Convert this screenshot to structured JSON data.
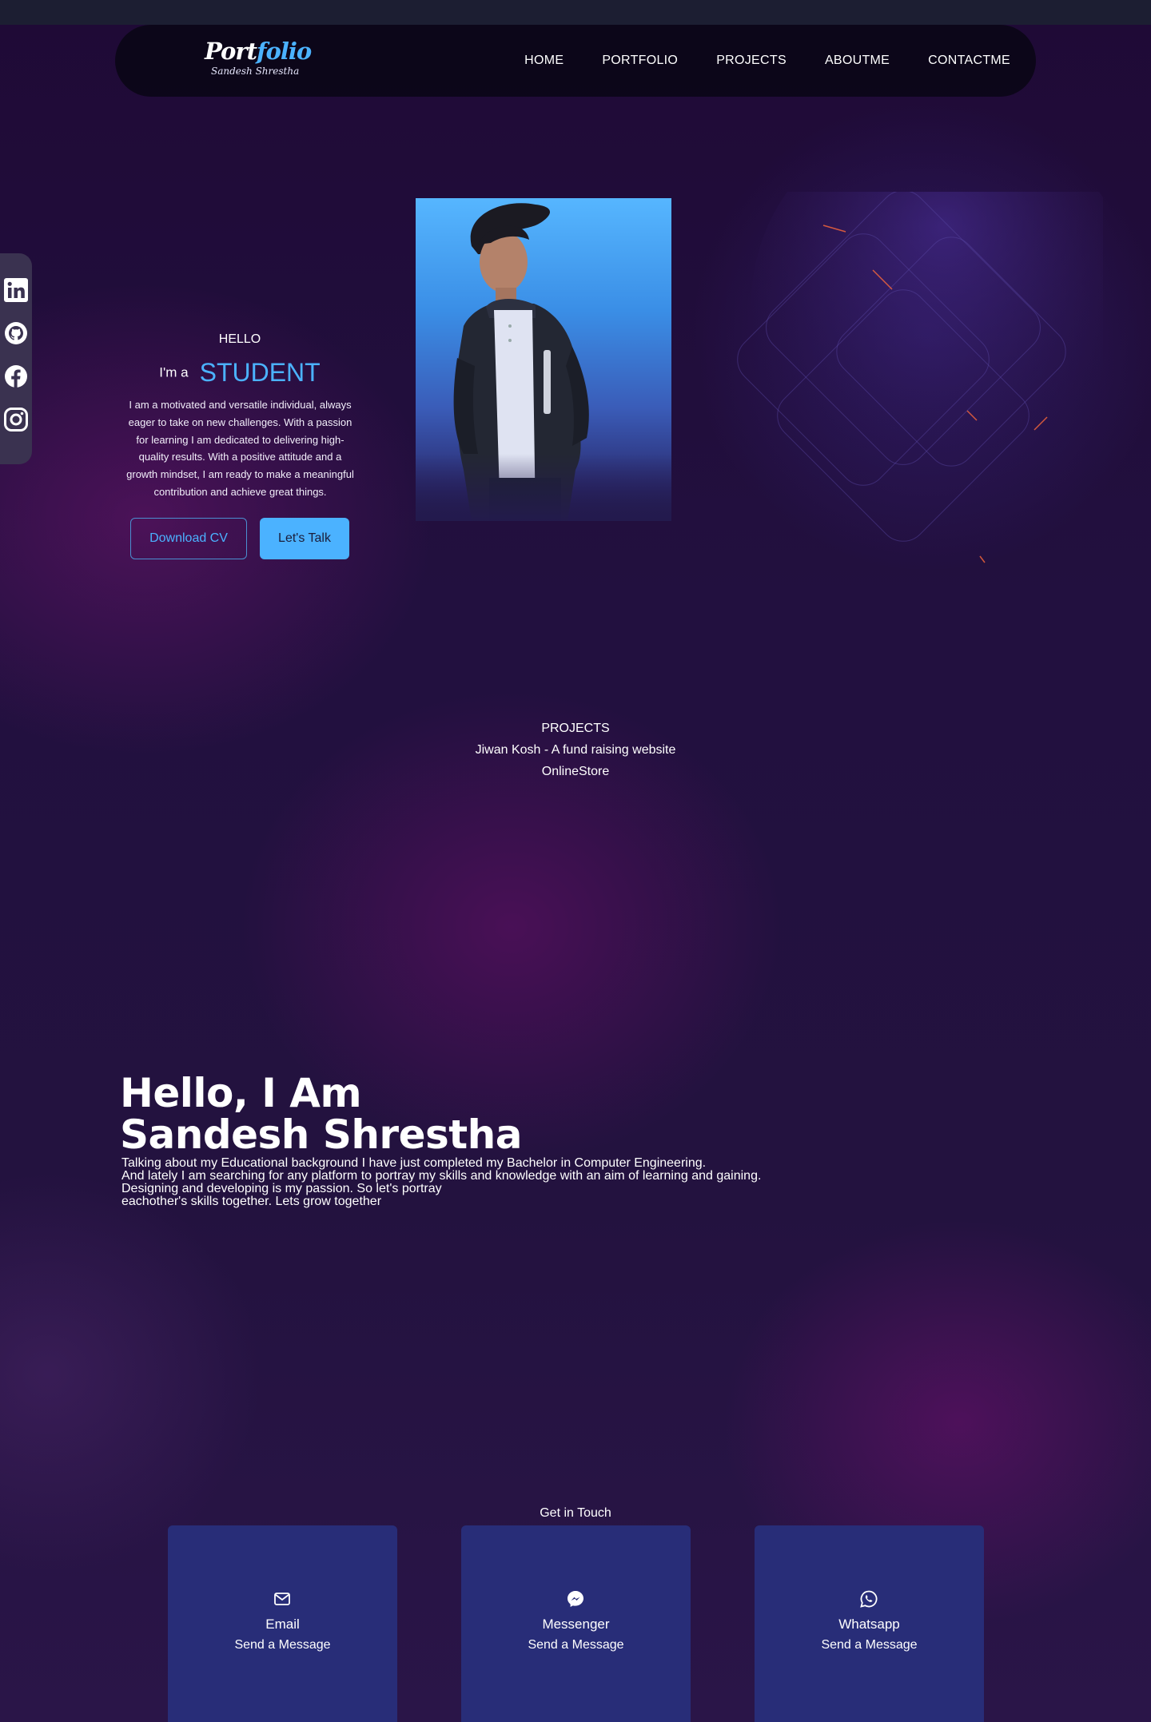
{
  "nav": {
    "logo_main_a": "Port",
    "logo_main_b": "folio",
    "logo_sub": "Sandesh Shrestha",
    "links": [
      "HOME",
      "PORTFOLIO",
      "PROJECTS",
      "ABOUTME",
      "CONTACTME"
    ]
  },
  "social": {
    "icons": [
      "linkedin-icon",
      "github-icon",
      "facebook-icon",
      "instagram-icon"
    ]
  },
  "hero": {
    "greeting": "HELLO",
    "prefix": "I'm a",
    "role": "STUDENT",
    "intro": "I am a motivated and versatile individual, always eager to take on new challenges. With a passion for learning I am dedicated to delivering high-quality results. With a positive attitude and a growth mindset, I am ready to make a meaningful contribution and achieve great things.",
    "download_label": "Download CV",
    "talk_label": "Let's Talk"
  },
  "projects": {
    "heading": "PROJECTS",
    "items": [
      "Jiwan Kosh - A fund raising website",
      "OnlineStore"
    ]
  },
  "about": {
    "line1": "Hello, I Am",
    "line2": "Sandesh Shrestha",
    "p1": "Talking about my Educational background I have just completed my Bachelor in Computer Engineering.",
    "p2": "And lately I am searching for any platform to portray my skills and knowledge with an aim of learning and gaining.",
    "p3": "Designing and developing is my passion. So let's portray",
    "p4": "eachother's skills together. Lets grow together"
  },
  "contact": {
    "heading": "Get in Touch",
    "cards": [
      {
        "title": "Email",
        "sub": "Send a Message",
        "icon": "mail-icon"
      },
      {
        "title": "Messenger",
        "sub": "Send a Message",
        "icon": "messenger-icon"
      },
      {
        "title": "Whatsapp",
        "sub": "Send a Message",
        "icon": "whatsapp-icon"
      }
    ]
  },
  "colors": {
    "accent": "#4bb2ff",
    "card": "#282d78",
    "nav_bg": "#0a0616"
  }
}
